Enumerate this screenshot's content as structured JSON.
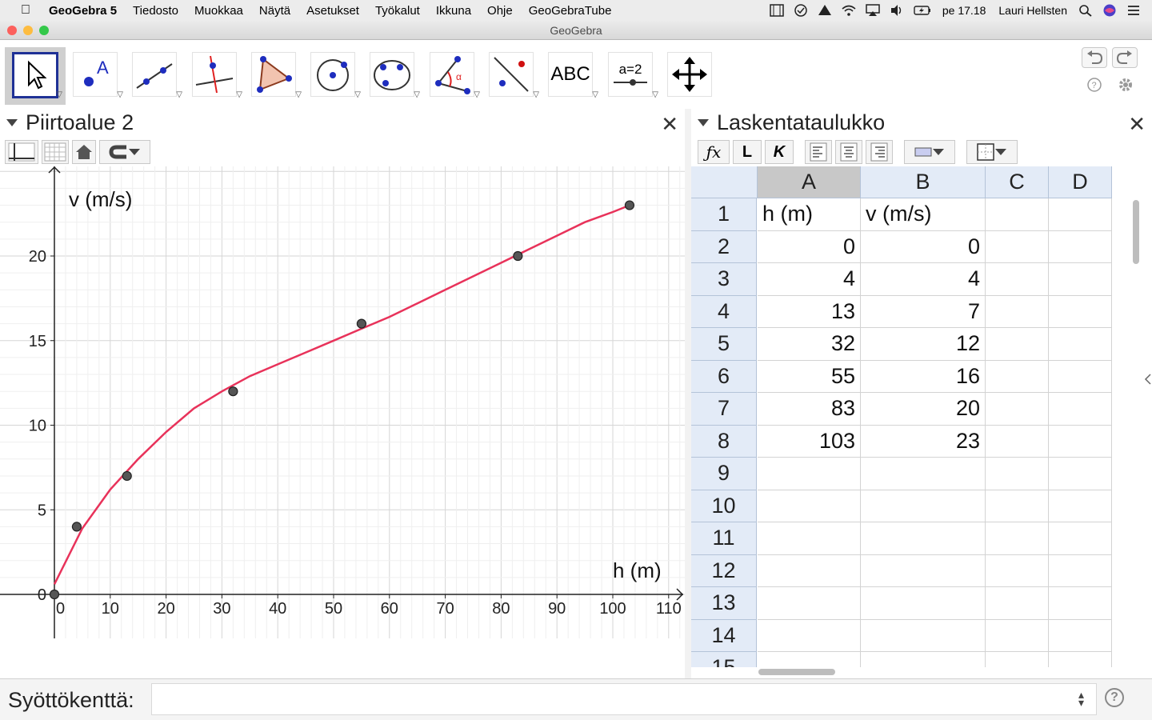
{
  "menubar": {
    "app_name": "GeoGebra 5",
    "menus": [
      "Tiedosto",
      "Muokkaa",
      "Näytä",
      "Asetukset",
      "Työkalut",
      "Ikkuna",
      "Ohje",
      "GeoGebraTube"
    ],
    "clock": "pe 17.18",
    "user": "Lauri Hellsten"
  },
  "window": {
    "title": "GeoGebra"
  },
  "toolbar": {
    "tools": [
      "move",
      "point",
      "line",
      "perpendicular-line",
      "polygon",
      "circle",
      "conic",
      "angle",
      "reflect",
      "text",
      "slider",
      "move-graphics-view"
    ],
    "text_tool_label": "ABC",
    "slider_tool_label": "a=2"
  },
  "graphics": {
    "title": "Piirtoalue 2",
    "xlabel": "h (m)",
    "ylabel": "v (m/s)"
  },
  "chart_data": {
    "type": "scatter",
    "xlabel": "h (m)",
    "ylabel": "v (m/s)",
    "xlim": [
      0,
      110
    ],
    "ylim": [
      0,
      25
    ],
    "x_ticks": [
      0,
      10,
      20,
      30,
      40,
      50,
      60,
      70,
      80,
      90,
      100,
      110
    ],
    "y_ticks": [
      0,
      5,
      10,
      15,
      20
    ],
    "grid": true,
    "points": {
      "x": [
        0,
        4,
        13,
        32,
        55,
        83,
        103
      ],
      "y": [
        0,
        4,
        7,
        12,
        16,
        20,
        23
      ]
    },
    "fit_curve": {
      "x": [
        0,
        5,
        10,
        15,
        20,
        25,
        30,
        35,
        40,
        45,
        50,
        55,
        60,
        65,
        70,
        75,
        80,
        85,
        90,
        95,
        100,
        103
      ],
      "y": [
        0.6,
        3.9,
        6.2,
        8.0,
        9.6,
        11.0,
        12.0,
        12.9,
        13.6,
        14.3,
        15.0,
        15.7,
        16.4,
        17.2,
        18.0,
        18.8,
        19.6,
        20.4,
        21.2,
        22.0,
        22.6,
        23.0
      ]
    },
    "colors": {
      "curve": "#e8325a",
      "points": "#555555"
    }
  },
  "spreadsheet": {
    "title": "Laskentataulukko",
    "bold_label": "L",
    "italic_label": "K",
    "columns": [
      "A",
      "B",
      "C",
      "D"
    ],
    "rows": [
      [
        "h (m)",
        "v (m/s)",
        "",
        ""
      ],
      [
        "0",
        "0",
        "",
        ""
      ],
      [
        "4",
        "4",
        "",
        ""
      ],
      [
        "13",
        "7",
        "",
        ""
      ],
      [
        "32",
        "12",
        "",
        ""
      ],
      [
        "55",
        "16",
        "",
        ""
      ],
      [
        "83",
        "20",
        "",
        ""
      ],
      [
        "103",
        "23",
        "",
        ""
      ],
      [
        "",
        "",
        "",
        ""
      ],
      [
        "",
        "",
        "",
        ""
      ],
      [
        "",
        "",
        "",
        ""
      ],
      [
        "",
        "",
        "",
        ""
      ],
      [
        "",
        "",
        "",
        ""
      ],
      [
        "",
        "",
        "",
        ""
      ],
      [
        "",
        "",
        "",
        ""
      ]
    ]
  },
  "inputbar": {
    "label": "Syöttökenttä:",
    "value": ""
  }
}
